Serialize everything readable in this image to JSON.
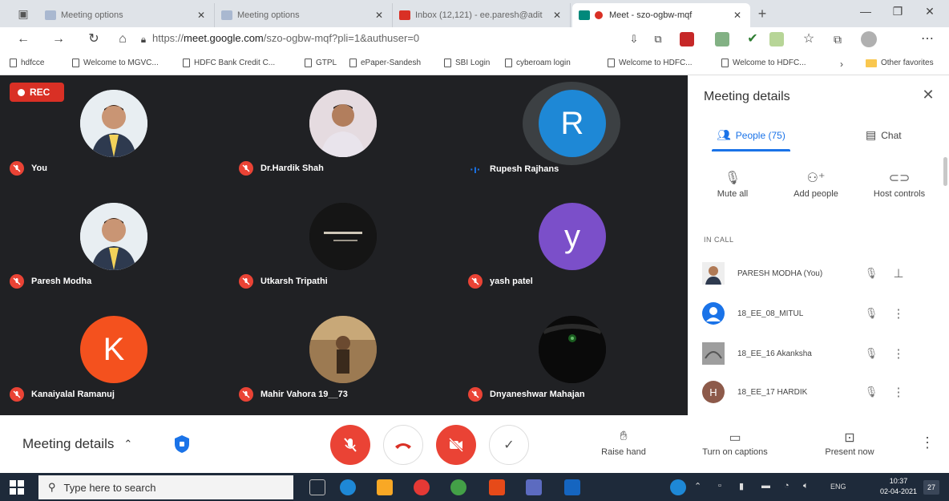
{
  "browser": {
    "tabs": [
      {
        "title": "Meeting options",
        "favicon_color": "#a9b8d0",
        "active": false
      },
      {
        "title": "Meeting options",
        "favicon_color": "#a9b8d0",
        "active": false
      },
      {
        "title": "Inbox (12,121) - ee.paresh@adit",
        "favicon_color": "#d93025",
        "active": false
      },
      {
        "title": "Meet - szo-ogbw-mqf",
        "favicon_color": "#00897b",
        "active": true
      }
    ],
    "url_prefix": "https://",
    "url_host": "meet.google.com",
    "url_path": "/szo-ogbw-mqf?pli=1&authuser=0",
    "bookmarks": [
      "hdfcce",
      "Welcome to MGVC...",
      "HDFC Bank Credit C...",
      "GTPL",
      "ePaper-Sandesh",
      "SBI Login",
      "cyberoam login",
      "Welcome to HDFC...",
      "Welcome to HDFC...",
      "Other favorites"
    ]
  },
  "stage": {
    "rec_label": "REC",
    "tiles": [
      {
        "name": "You",
        "type": "photo",
        "muted": true
      },
      {
        "name": "Dr.Hardik Shah",
        "type": "photo",
        "muted": true
      },
      {
        "name": "Rupesh Rajhans",
        "type": "initial",
        "initial": "R",
        "color": "#1e88d6",
        "muted": false,
        "speaking": true
      },
      {
        "name": "Paresh Modha",
        "type": "photo",
        "muted": true
      },
      {
        "name": "Utkarsh Tripathi",
        "type": "photo-dark",
        "muted": true
      },
      {
        "name": "yash patel",
        "type": "initial",
        "initial": "y",
        "color": "#7b4fc9",
        "muted": true
      },
      {
        "name": "Kanaiyalal Ramanuj",
        "type": "initial",
        "initial": "K",
        "color": "#f4511e",
        "muted": true
      },
      {
        "name": "Mahir Vahora 19__73",
        "type": "photo-warm",
        "muted": true
      },
      {
        "name": "Dnyaneshwar Mahajan",
        "type": "photo-dark",
        "muted": true
      }
    ]
  },
  "panel": {
    "title": "Meeting details",
    "tab_people": "People (75)",
    "tab_chat": "Chat",
    "controls": [
      "Mute all",
      "Add people",
      "Host controls"
    ],
    "in_call_label": "IN CALL",
    "participants": [
      {
        "name": "PARESH MODHA (You)",
        "avatar": "photo",
        "color": "#d9a77b"
      },
      {
        "name": "18_EE_08_MITUL",
        "avatar": "silhouette",
        "color": "#1a73e8"
      },
      {
        "name": "18_EE_16 Akanksha",
        "avatar": "photo",
        "color": "#8a8a8a"
      },
      {
        "name": "18_EE_17 HARDIK",
        "avatar": "initial",
        "initial": "H",
        "color": "#8d5a4a"
      }
    ]
  },
  "bottom": {
    "meeting_details": "Meeting details",
    "raise_hand": "Raise hand",
    "captions": "Turn on captions",
    "present": "Present now"
  },
  "taskbar": {
    "search_placeholder": "Type here to search",
    "lang": "ENG",
    "time": "10:37",
    "date": "02-04-2021",
    "notif_count": "27"
  }
}
